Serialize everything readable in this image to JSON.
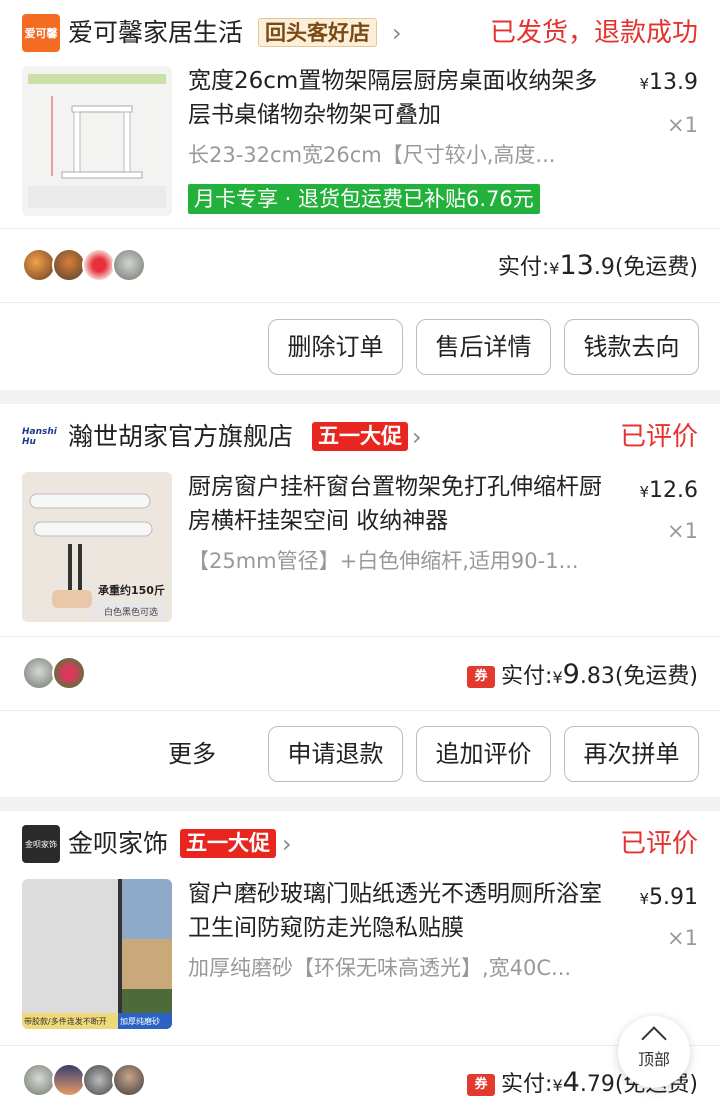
{
  "orders": [
    {
      "shop_logo_text": "爱可馨",
      "shop_name": "爱可馨家居生活",
      "shop_tag": "回头客好店",
      "status": "已发货，退款成功",
      "title": "宽度26cm置物架隔层厨房桌面收纳架多层书桌储物杂物架可叠加",
      "spec": "长23-32cm宽26cm【尺寸较小,高度...",
      "price_symbol": "¥",
      "price": "13.9",
      "qty": "×1",
      "promo": "月卡专享 · 退货包运费已补贴6.76元",
      "paid_label": "实付:",
      "paid_symbol": "¥",
      "paid_int": "13",
      "paid_dec": ".9",
      "shipping": "(免运费)",
      "buttons": [
        "删除订单",
        "售后详情",
        "钱款去向"
      ]
    },
    {
      "shop_logo_text": "Hanshi Hu",
      "shop_name": "瀚世胡家官方旗舰店",
      "shop_tag": "五一大促",
      "status": "已评价",
      "title": "厨房窗户挂杆窗台置物架免打孔伸缩杆厨房横杆挂架空间 收纳神器",
      "spec": "【25mm管径】+白色伸缩杆,适用90-1...",
      "price_symbol": "¥",
      "price": "12.6",
      "qty": "×1",
      "image_caption_1": "承重约150斤",
      "image_caption_2": "白色黑色可选",
      "coupon": "券",
      "paid_label": "实付:",
      "paid_symbol": "¥",
      "paid_int": "9",
      "paid_dec": ".83",
      "shipping": "(免运费)",
      "more": "更多",
      "buttons": [
        "申请退款",
        "追加评价",
        "再次拼单"
      ]
    },
    {
      "shop_logo_text": "金呗家饰",
      "shop_name": "金呗家饰",
      "shop_tag": "五一大促",
      "status": "已评价",
      "title": "窗户磨砂玻璃门贴纸透光不透明厕所浴室卫生间防窥防走光隐私贴膜",
      "spec": "加厚纯磨砂【环保无味高透光】,宽40C...",
      "price_symbol": "¥",
      "price": "5.91",
      "qty": "×1",
      "image_caption_1": "带胶款/多件连发不断开",
      "image_caption_2": "加厚纯磨砂",
      "coupon": "券",
      "paid_label": "实付:",
      "paid_symbol": "¥",
      "paid_int": "4",
      "paid_dec": ".79",
      "shipping": "(免运费)"
    }
  ],
  "back_to_top": "顶部",
  "colors": {
    "status_red": "#e5322d",
    "promo_green": "#22b13b",
    "tag_red": "#e8251e"
  }
}
